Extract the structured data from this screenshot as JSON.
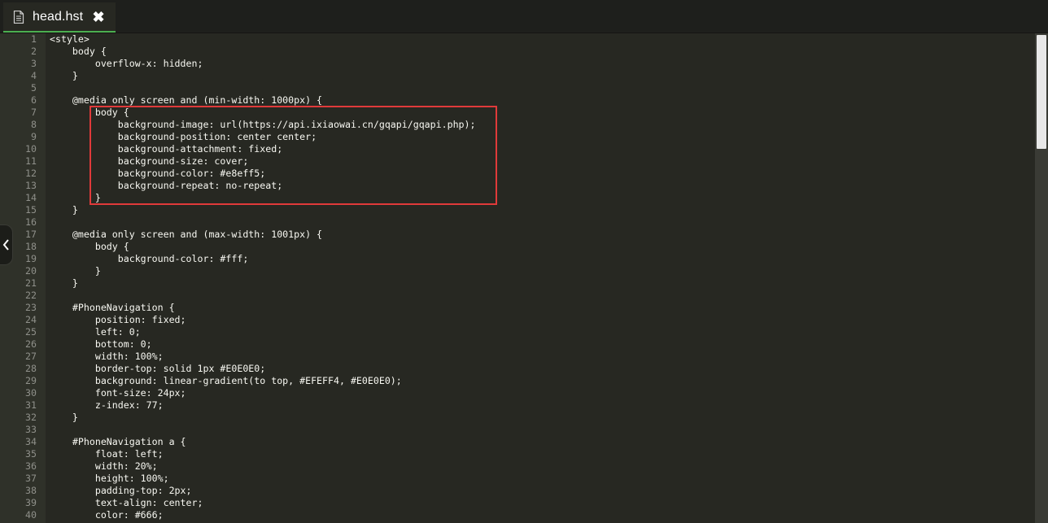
{
  "tab": {
    "title": "head.hst",
    "close_glyph": "✖",
    "icon": "document-icon"
  },
  "editor": {
    "lines": [
      "<style>",
      "    body {",
      "        overflow-x: hidden;",
      "    }",
      "",
      "    @media only screen and (min-width: 1000px) {",
      "        body {",
      "            background-image: url(https://api.ixiaowai.cn/gqapi/gqapi.php);",
      "            background-position: center center;",
      "            background-attachment: fixed;",
      "            background-size: cover;",
      "            background-color: #e8eff5;",
      "            background-repeat: no-repeat;",
      "        }",
      "    }",
      "",
      "    @media only screen and (max-width: 1001px) {",
      "        body {",
      "            background-color: #fff;",
      "        }",
      "    }",
      "",
      "    #PhoneNavigation {",
      "        position: fixed;",
      "        left: 0;",
      "        bottom: 0;",
      "        width: 100%;",
      "        border-top: solid 1px #E0E0E0;",
      "        background: linear-gradient(to top, #EFEFF4, #E0E0E0);",
      "        font-size: 24px;",
      "        z-index: 77;",
      "    }",
      "",
      "    #PhoneNavigation a {",
      "        float: left;",
      "        width: 20%;",
      "        height: 100%;",
      "        padding-top: 2px;",
      "        text-align: center;",
      "        color: #666;"
    ]
  },
  "colors": {
    "background": "#272822",
    "highlight_border": "#e03a3a",
    "tab_underline": "#4caf50"
  }
}
